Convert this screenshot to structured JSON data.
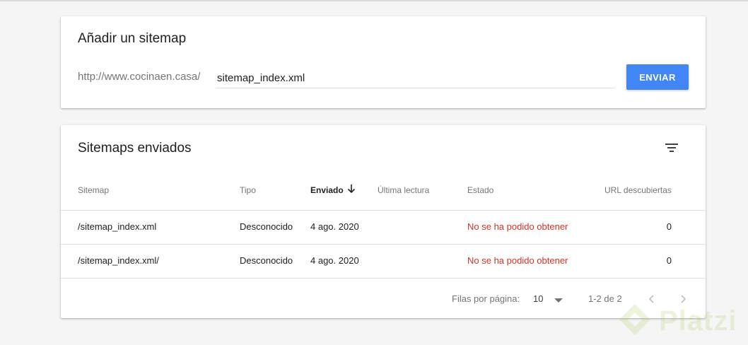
{
  "add_sitemap": {
    "title": "Añadir un sitemap",
    "url_prefix": "http://www.cocinaen.casa/",
    "input_value": "sitemap_index.xml",
    "submit_label": "ENVIAR"
  },
  "sent_sitemaps": {
    "title": "Sitemaps enviados",
    "columns": [
      "Sitemap",
      "Tipo",
      "Enviado",
      "Última lectura",
      "Estado",
      "URL descubiertas"
    ],
    "sorted_column": "Enviado",
    "rows": [
      {
        "sitemap": "/sitemap_index.xml",
        "tipo": "Desconocido",
        "enviado": "4 ago. 2020",
        "ultima_lectura": "",
        "estado": "No se ha podido obtener",
        "urls": "0"
      },
      {
        "sitemap": "/sitemap_index.xml/",
        "tipo": "Desconocido",
        "enviado": "4 ago. 2020",
        "ultima_lectura": "",
        "estado": "No se ha podido obtener",
        "urls": "0"
      }
    ],
    "footer": {
      "rows_per_page_label": "Filas por página:",
      "rows_per_page_value": "10",
      "range": "1-2 de 2"
    }
  },
  "watermark": {
    "text": "Platzi"
  },
  "colors": {
    "accent": "#4285f4",
    "error": "#d93025",
    "watermark": "#98ca3f"
  },
  "icons": [
    "filter-icon",
    "arrow-down-icon",
    "chevron-down-icon",
    "chevron-left-icon",
    "chevron-right-icon",
    "platzi-logo-icon"
  ]
}
